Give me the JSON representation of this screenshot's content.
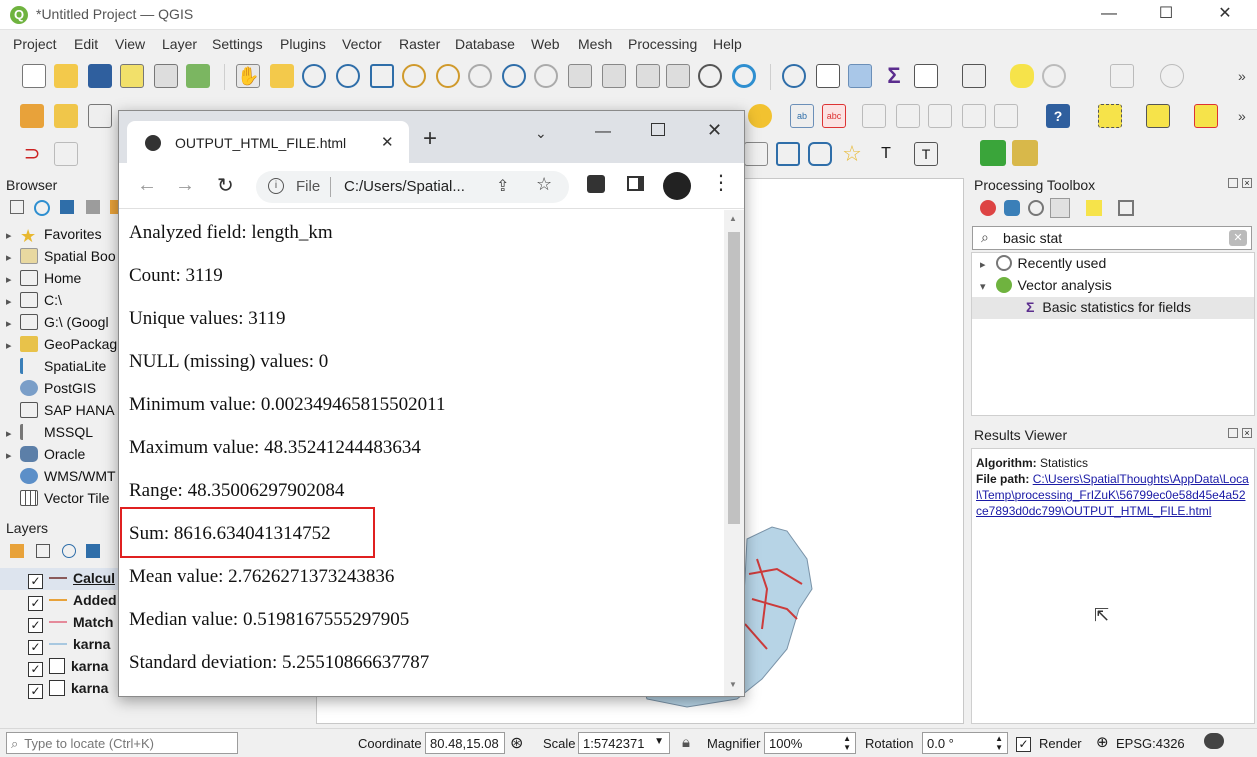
{
  "window": {
    "title": "*Untitled Project — QGIS",
    "minimize": "—",
    "maximize": "☐",
    "close": "✕"
  },
  "menu": [
    "Project",
    "Edit",
    "View",
    "Layer",
    "Settings",
    "Plugins",
    "Vector",
    "Raster",
    "Database",
    "Web",
    "Mesh",
    "Processing",
    "Help"
  ],
  "browser": {
    "title": "Browser",
    "items": [
      "Favorites",
      "Spatial Boo",
      "Home",
      "C:\\",
      "G:\\ (Googl",
      "GeoPackag",
      "SpatiaLite",
      "PostGIS",
      "SAP HANA",
      "MSSQL",
      "Oracle",
      "WMS/WMT",
      "Vector Tile"
    ]
  },
  "layers": {
    "title": "Layers",
    "items": [
      "Calcul",
      "Added",
      "Match",
      "karna",
      "karna",
      "karna"
    ]
  },
  "processing_toolbox": {
    "title": "Processing Toolbox",
    "search_value": "basic stat",
    "tree": {
      "recently_used": "Recently used",
      "vector_analysis": "Vector analysis",
      "basic_statistics": "Basic statistics for fields"
    }
  },
  "results_viewer": {
    "title": "Results Viewer",
    "algorithm_label": "Algorithm:",
    "algorithm_value": "Statistics",
    "file_path_label": "File path:",
    "file_path_link": "C:\\Users\\SpatialThoughts\\AppData\\Local\\Temp\\processing_FrIZuK\\56799ec0e58d45e4a52ce7893d0dc799\\OUTPUT_HTML_FILE.html"
  },
  "statusbar": {
    "locate_placeholder": "Type to locate (Ctrl+K)",
    "coordinate_label": "Coordinate",
    "coordinate_value": "80.48,15.08",
    "scale_label": "Scale",
    "scale_value": "1:5742371",
    "magnifier_label": "Magnifier",
    "magnifier_value": "100%",
    "rotation_label": "Rotation",
    "rotation_value": "0.0 °",
    "render_label": "Render",
    "crs": "EPSG:4326"
  },
  "chrome": {
    "tab_title": "OUTPUT_HTML_FILE.html",
    "new_tab": "+",
    "address_scheme": "File",
    "address_url": "C:/Users/Spatial...",
    "stats": [
      "Analyzed field: length_km",
      "Count: 3119",
      "Unique values: 3119",
      "NULL (missing) values: 0",
      "Minimum value: 0.002349465815502011",
      "Maximum value: 48.35241244483634",
      "Range: 48.35006297902084",
      "Sum: 8616.634041314752",
      "Mean value: 2.7626271373243836",
      "Median value: 0.5198167555297905",
      "Standard deviation: 5.25510866637787"
    ],
    "highlight_color": "#e02020"
  }
}
